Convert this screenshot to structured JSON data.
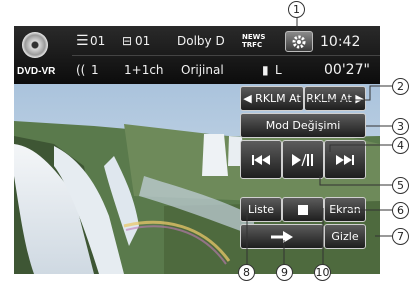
{
  "status": {
    "source": "DVD-VR",
    "title_num": "01",
    "chapter_num": "01",
    "audio_format": "Dolby D",
    "audio_track": "1",
    "channels": "1+1ch",
    "subtitle": "Orijinal",
    "news_traffic": [
      "NEWS",
      "TRFC"
    ],
    "clock": "10:42",
    "elapsed": "00'27\"",
    "lr_indicator": "L"
  },
  "buttons": {
    "rklm_back": "RKLM At",
    "rklm_fwd": "RKLM At",
    "mode_change": "Mod Değişimi",
    "list": "Liste",
    "screen": "Ekran",
    "hide": "Gizle"
  },
  "callouts": [
    "1",
    "2",
    "3",
    "4",
    "5",
    "6",
    "7",
    "8",
    "9",
    "10"
  ],
  "colors": {
    "button_border": "#d0d0d0",
    "status_bg": "#111111",
    "text": "#ffffff"
  }
}
